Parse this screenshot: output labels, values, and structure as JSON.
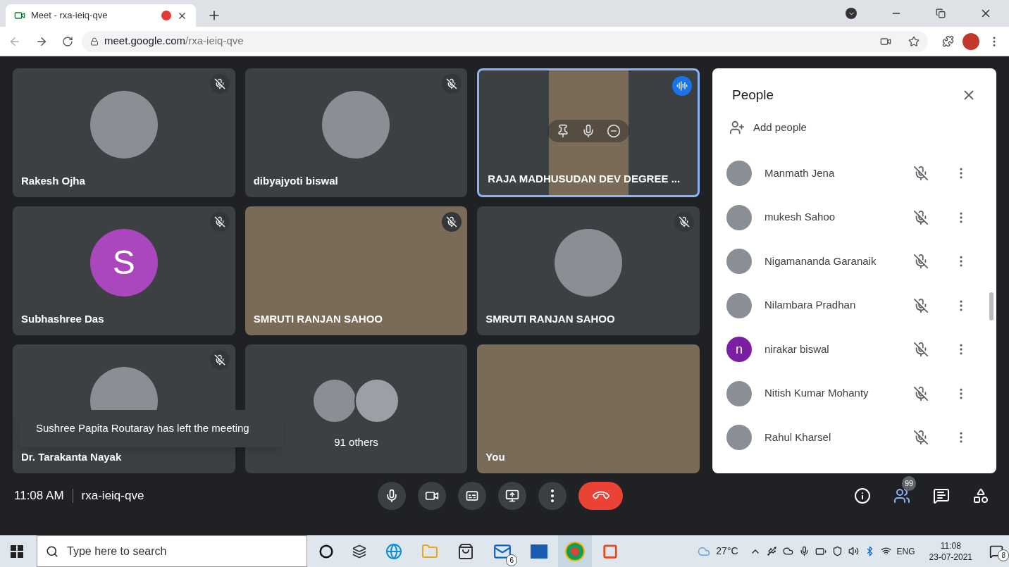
{
  "browser": {
    "tab": {
      "title": "Meet - rxa-ieiq-qve",
      "recording": true
    },
    "url": {
      "host": "meet.google.com",
      "path": "/rxa-ieiq-qve"
    }
  },
  "tiles": [
    {
      "kind": "avatar",
      "name": "Rakesh Ojha",
      "muted": true,
      "speaking": false,
      "avatar": {
        "kind": "photo"
      }
    },
    {
      "kind": "avatar",
      "name": "dibyajyoti biswal",
      "muted": true,
      "speaking": false,
      "avatar": {
        "kind": "photo"
      }
    },
    {
      "kind": "video",
      "name": "RAJA MADHUSUDAN DEV DEGREE ...",
      "speaking": true,
      "narrow": true
    },
    {
      "kind": "avatar",
      "name": "Subhashree Das",
      "muted": true,
      "speaking": false,
      "avatar": {
        "kind": "letter",
        "letter": "S",
        "color": "#aa47bc"
      }
    },
    {
      "kind": "video",
      "name": "SMRUTI RANJAN SAHOO",
      "muted": true,
      "speaking": false,
      "narrow": false
    },
    {
      "kind": "avatar",
      "name": "SMRUTI RANJAN SAHOO",
      "muted": true,
      "speaking": false,
      "avatar": {
        "kind": "photo"
      }
    },
    {
      "kind": "avatar",
      "name": "Dr. Tarakanta Nayak",
      "muted": true,
      "speaking": false,
      "avatar": {
        "kind": "photo"
      }
    },
    {
      "kind": "others",
      "name": "91 others",
      "speaking": false
    },
    {
      "kind": "video",
      "name": "You",
      "speaking": false,
      "narrow": false
    }
  ],
  "toast": "Sushree Papita Routaray has left the meeting",
  "bottom_bar": {
    "time": "11:08 AM",
    "meeting_code": "rxa-ieiq-qve",
    "people_count": "99"
  },
  "people_panel": {
    "title": "People",
    "add_people": "Add people",
    "participants": [
      {
        "name": "Manmath Jena",
        "muted": true,
        "avatar": {
          "kind": "photo"
        }
      },
      {
        "name": "mukesh Sahoo",
        "muted": true,
        "avatar": {
          "kind": "photo"
        }
      },
      {
        "name": "Nigamananda Garanaik",
        "muted": true,
        "avatar": {
          "kind": "photo"
        }
      },
      {
        "name": "Nilambara Pradhan",
        "muted": true,
        "avatar": {
          "kind": "photo"
        }
      },
      {
        "name": "nirakar biswal",
        "muted": true,
        "avatar": {
          "kind": "letter",
          "letter": "n",
          "color": "#7b1fa2"
        }
      },
      {
        "name": "Nitish Kumar Mohanty",
        "muted": true,
        "avatar": {
          "kind": "photo"
        }
      },
      {
        "name": "Rahul Kharsel",
        "muted": true,
        "avatar": {
          "kind": "photo"
        }
      }
    ]
  },
  "taskbar": {
    "search_placeholder": "Type here to search",
    "mail_badge": "6",
    "weather": "27°C",
    "language": "ENG",
    "time": "11:08",
    "date": "23-07-2021",
    "notifications": "8"
  }
}
